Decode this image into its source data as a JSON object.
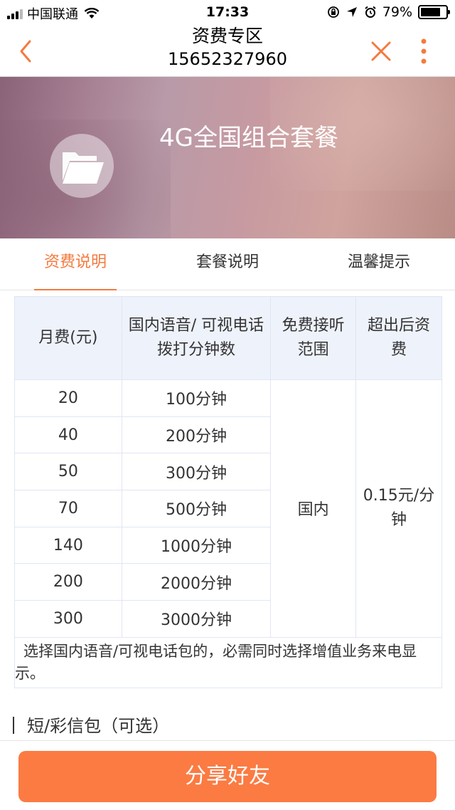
{
  "status_bar": {
    "carrier": "中国联通",
    "time": "17:33",
    "battery_percent": "79%",
    "battery_level": 0.79
  },
  "nav": {
    "title": "资费专区",
    "subtitle": "15652327960"
  },
  "banner": {
    "title": "4G全国组合套餐",
    "icon": "folder-icon"
  },
  "tabs": [
    {
      "label": "资费说明",
      "active": true
    },
    {
      "label": "套餐说明",
      "active": false
    },
    {
      "label": "温馨提示",
      "active": false
    }
  ],
  "fee_table": {
    "headers": [
      "月费(元)",
      "国内语音/ 可视电话 拨打分钟数",
      "免费接听范围",
      "超出后资费"
    ],
    "rows": [
      [
        "20",
        "100分钟"
      ],
      [
        "40",
        "200分钟"
      ],
      [
        "50",
        "300分钟"
      ],
      [
        "70",
        "500分钟"
      ],
      [
        "140",
        "1000分钟"
      ],
      [
        "200",
        "2000分钟"
      ],
      [
        "300",
        "3000分钟"
      ]
    ],
    "free_range": "国内",
    "overage_rate": "0.15元/分钟",
    "note": "选择国内语音/可视电话包的，必需同时选择增值业务来电显示。"
  },
  "section": {
    "title": "短/彩信包（可选）"
  },
  "share_button": {
    "label": "分享好友"
  },
  "colors": {
    "accent": "#f47a3e",
    "button": "#fb7b43",
    "table_header_bg": "#eef2fb"
  }
}
